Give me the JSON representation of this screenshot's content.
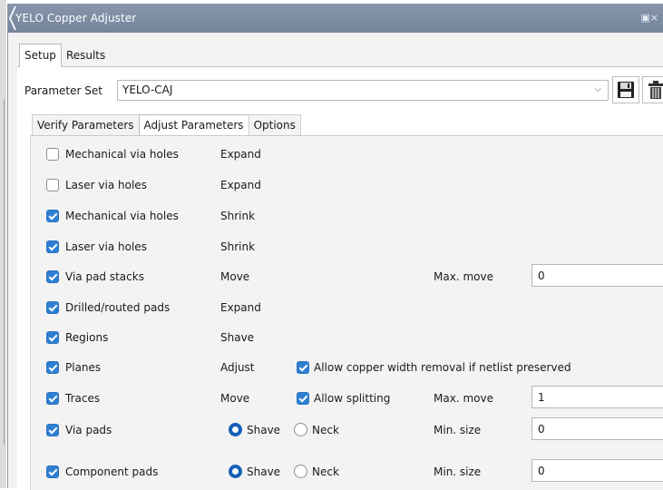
{
  "window": {
    "title": "YELO Copper Adjuster",
    "controls_icon": "restore-close-icon",
    "controls_text": "▣×"
  },
  "tabs": [
    {
      "label": "Setup",
      "active": true
    },
    {
      "label": "Results",
      "active": false
    }
  ],
  "parameter_set": {
    "label": "Parameter Set",
    "value": "YELO-CAJ",
    "save_icon": "floppy-disk-icon",
    "delete_icon": "trash-icon"
  },
  "subtabs": [
    {
      "label": "Verify Parameters",
      "active": false
    },
    {
      "label": "Adjust Parameters",
      "active": true
    },
    {
      "label": "Options",
      "active": false
    }
  ],
  "rows": [
    {
      "checked": false,
      "label": "Mechanical via holes",
      "action": "Expand"
    },
    {
      "checked": false,
      "label": "Laser via holes",
      "action": "Expand"
    },
    {
      "checked": true,
      "label": "Mechanical via holes",
      "action": "Shrink"
    },
    {
      "checked": true,
      "label": "Laser via holes",
      "action": "Shrink"
    },
    {
      "checked": true,
      "label": "Via pad stacks",
      "action": "Move",
      "field_label": "Max. move",
      "field_value": "0"
    },
    {
      "checked": true,
      "label": "Drilled/routed pads",
      "action": "Expand"
    },
    {
      "checked": true,
      "label": "Regions",
      "action": "Shave"
    },
    {
      "checked": true,
      "label": "Planes",
      "action": "Adjust",
      "extra_checked": true,
      "extra_label": "Allow copper width removal if netlist preserved"
    },
    {
      "checked": true,
      "label": "Traces",
      "action": "Move",
      "extra_checked": true,
      "extra_label": "Allow splitting",
      "field_label": "Max. move",
      "field_value": "1"
    },
    {
      "checked": true,
      "label": "Via pads",
      "radio1": "Shave",
      "radio2": "Neck",
      "selected": "Shave",
      "field_label": "Min. size",
      "field_value": "0"
    },
    {
      "checked": true,
      "label": "Component pads",
      "radio1": "Shave",
      "radio2": "Neck",
      "selected": "Shave",
      "field_label": "Min. size",
      "field_value": "0"
    }
  ],
  "colors": {
    "titlebar": "#7d8ca2",
    "checkbox_on": "#2d7fd3",
    "radio_on": "#1660b8",
    "panel": "#f3f3f3"
  }
}
